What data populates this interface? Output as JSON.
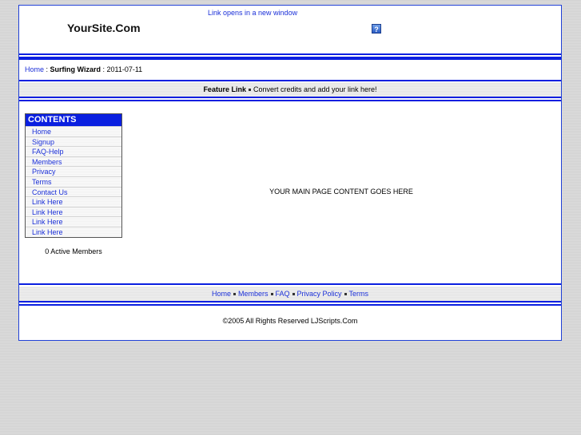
{
  "header": {
    "new_window_note": "Link opens in a new window",
    "site_title": "YourSite.Com",
    "help_icon_label": "?"
  },
  "breadcrumb": {
    "home": "Home",
    "sep1": " : ",
    "page": "Surfing Wizard",
    "sep2": " : ",
    "date": "2011-07-11"
  },
  "feature": {
    "label": "Feature Link",
    "text": "Convert credits and add your link here!"
  },
  "contents": {
    "title": "CONTENTS",
    "items": [
      "Home",
      "Signup",
      "FAQ-Help",
      "Members",
      "Privacy",
      "Terms",
      "Contact Us",
      "Link Here",
      "Link Here",
      "Link Here",
      "Link Here"
    ],
    "active_members": "0 Active Members"
  },
  "main": {
    "placeholder": "YOUR MAIN PAGE CONTENT GOES HERE"
  },
  "footer": {
    "links": [
      "Home",
      "Members",
      "FAQ",
      "Privacy Policy",
      "Terms"
    ],
    "copyright": "©2005 All Rights Reserved LJScripts.Com"
  },
  "colors": {
    "accent_blue": "#0a1fe0",
    "link_blue": "#1a2fd8",
    "page_bg": "#d6d6d6"
  }
}
